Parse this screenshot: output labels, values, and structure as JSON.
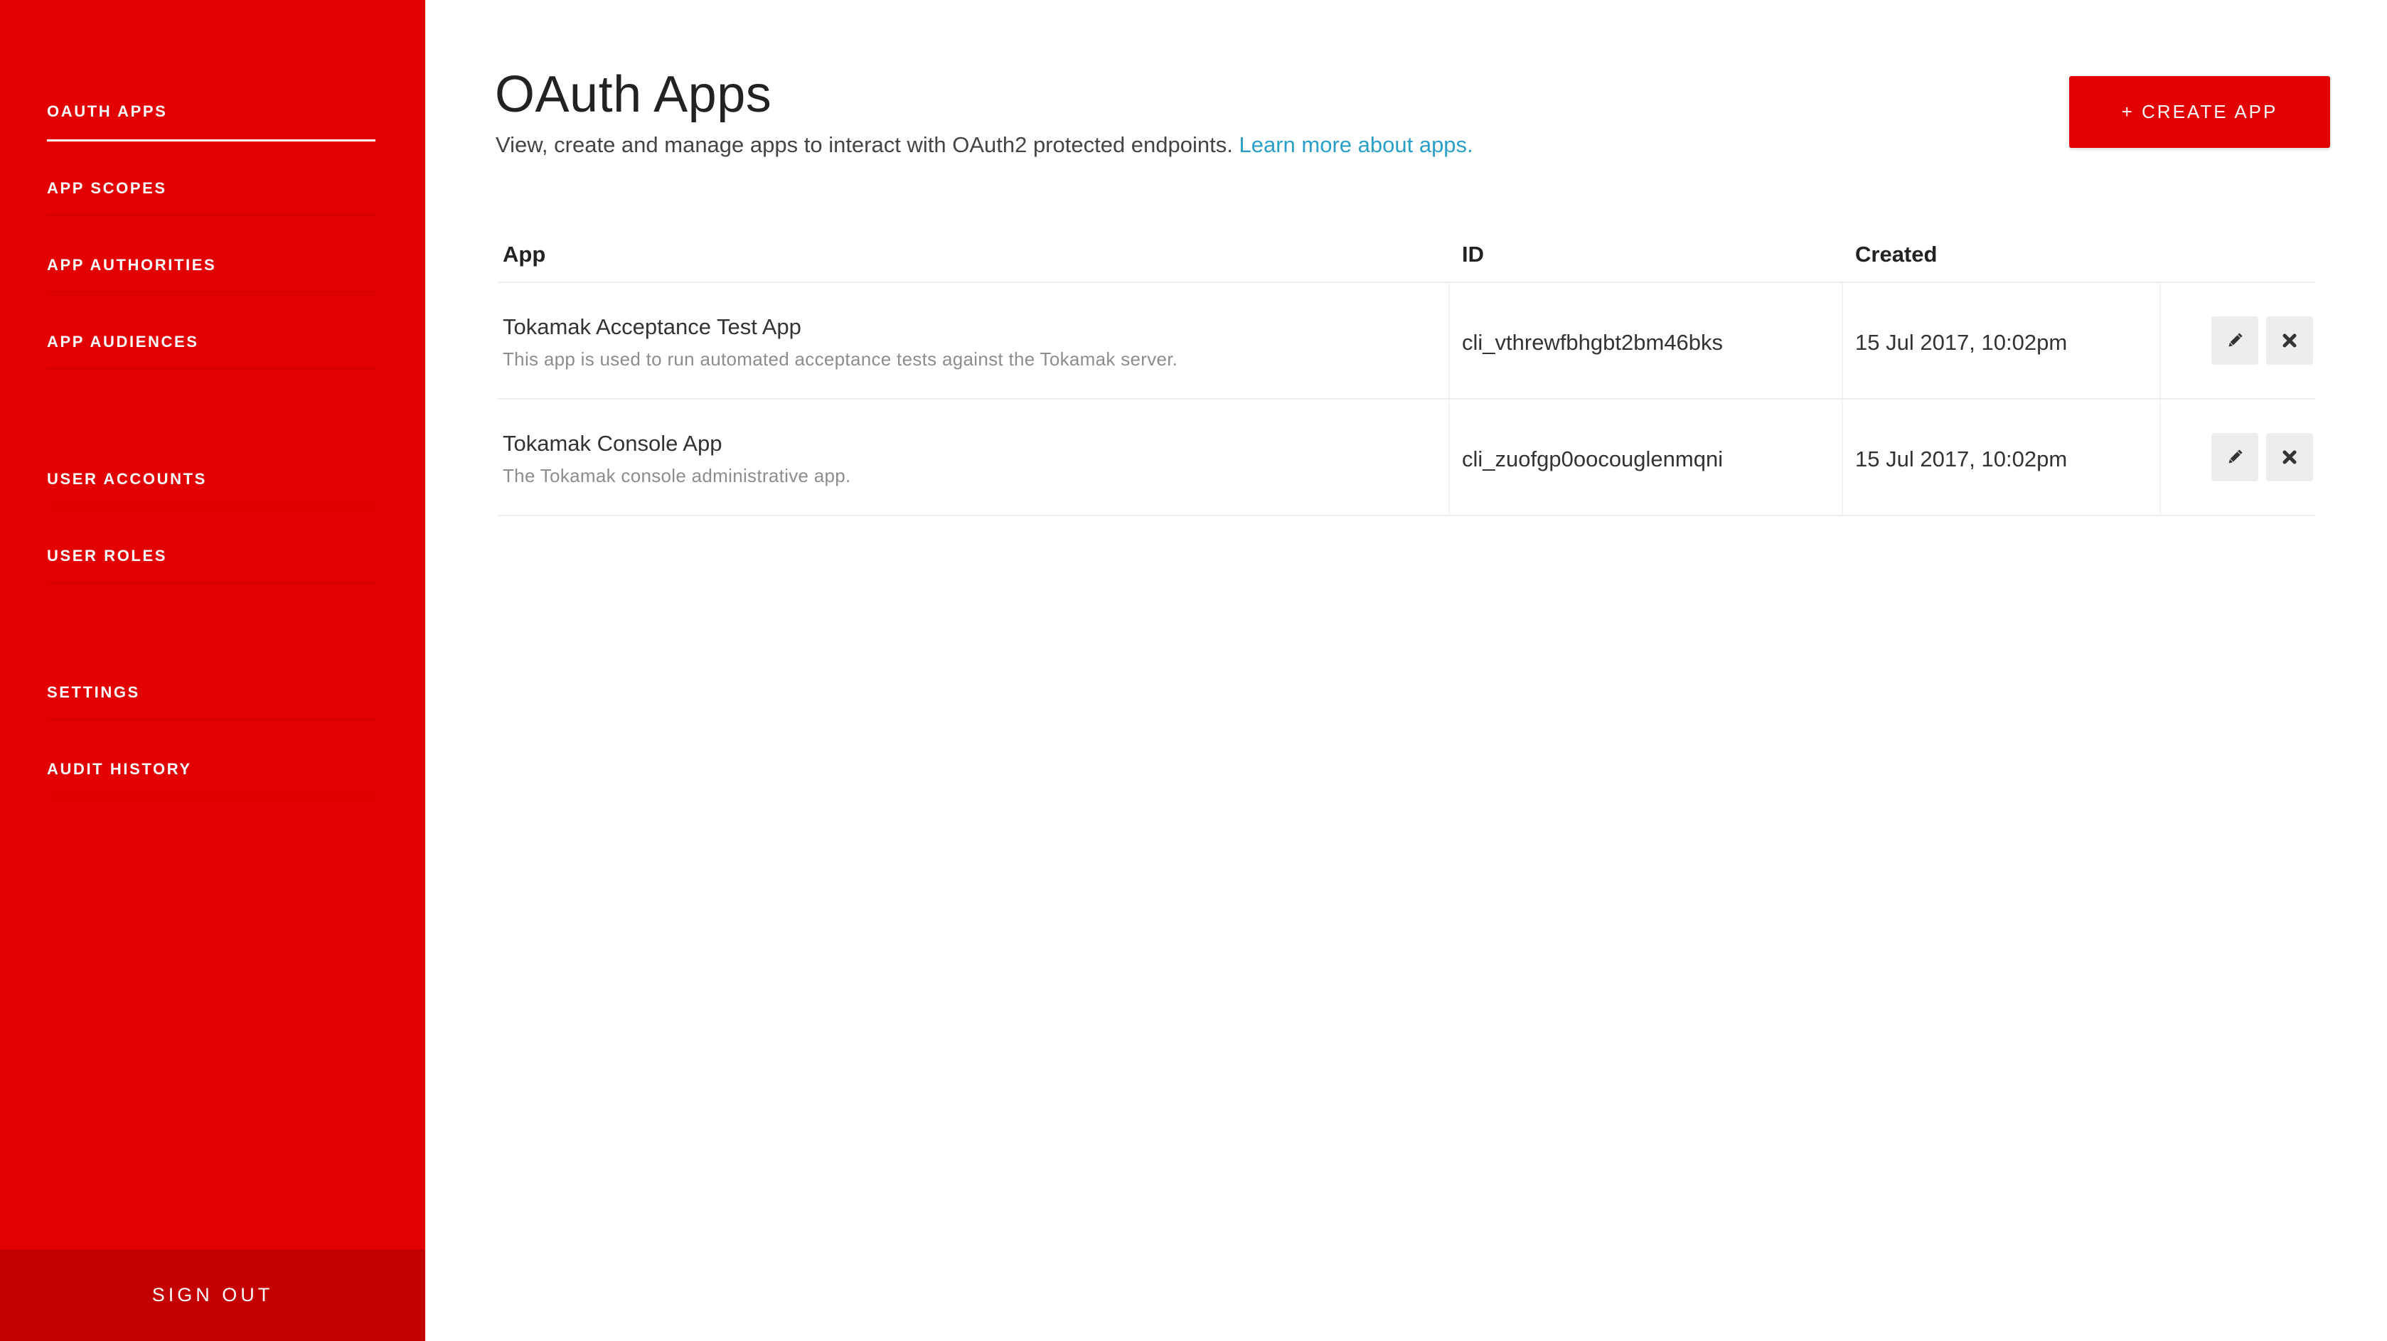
{
  "sidebar": {
    "items": [
      {
        "label": "OAUTH APPS"
      },
      {
        "label": "APP SCOPES"
      },
      {
        "label": "APP AUTHORITIES"
      },
      {
        "label": "APP AUDIENCES"
      },
      {
        "label": "USER ACCOUNTS"
      },
      {
        "label": "USER ROLES"
      },
      {
        "label": "SETTINGS"
      },
      {
        "label": "AUDIT HISTORY"
      }
    ],
    "active_item": "OAUTH APPS",
    "sign_out": "SIGN OUT"
  },
  "header": {
    "title": "OAuth Apps",
    "description": "View, create and manage apps to interact with OAuth2 protected endpoints.",
    "learn_more": "Learn more about apps.",
    "create_button": "+ CREATE APP"
  },
  "table": {
    "columns": [
      "App",
      "ID",
      "Created"
    ],
    "rows": [
      {
        "name": "Tokamak Acceptance Test App",
        "description": "This app is used to run automated acceptance tests against the Tokamak server.",
        "id": "cli_vthrewfbhgbt2bm46bks",
        "created": "15 Jul 2017, 10:02pm",
        "actions": [
          "pencil-icon",
          "close-icon"
        ]
      },
      {
        "name": "Tokamak Console App",
        "description": "The Tokamak console administrative app.",
        "id": "cli_zuofgp0oocouglenmqni",
        "created": "15 Jul 2017, 10:02pm",
        "actions": [
          "pencil-icon",
          "close-icon"
        ]
      }
    ]
  },
  "colors": {
    "brand_red": "#e20000",
    "sign_out_bg": "#c50000",
    "link_blue": "#2a9fc7",
    "action_button_bg": "#ededed"
  }
}
